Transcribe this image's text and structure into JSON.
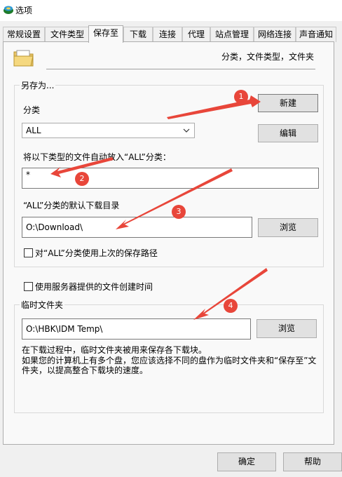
{
  "window": {
    "title": "选项"
  },
  "tabs": [
    {
      "label": "常规设置"
    },
    {
      "label": "文件类型"
    },
    {
      "label": "保存至"
    },
    {
      "label": "下载"
    },
    {
      "label": "连接"
    },
    {
      "label": "代理"
    },
    {
      "label": "站点管理"
    },
    {
      "label": "网络连接"
    },
    {
      "label": "声音通知"
    }
  ],
  "header": {
    "caption": "分类，文件类型，文件夹"
  },
  "save_as": {
    "group_title": "另存为...",
    "category_label": "分类",
    "category_value": "ALL",
    "new_button": "新建",
    "edit_button": "编辑",
    "auto_types_label": "将以下类型的文件自动放入“ALL”分类：",
    "auto_types_value": "*",
    "default_dir_label": "“ALL”分类的默认下载目录",
    "default_dir_value": "O:\\Download\\",
    "browse_button": "浏览",
    "last_path_checkbox": "对“ALL”分类使用上次的保存路径"
  },
  "server_time_checkbox": "使用服务器提供的文件创建时间",
  "temp_folder": {
    "group_title": "临时文件夹",
    "path_value": "O:\\HBK\\IDM Temp\\",
    "browse_button": "浏览",
    "note_line1": "在下载过程中，临时文件夹被用来保存各下载块。",
    "note_line2": "如果您的计算机上有多个盘，您应该选择不同的盘作为临时文件夹和“保存至”文",
    "note_line3": "件夹，以提高整合下载块的速度。"
  },
  "footer": {
    "ok_button": "确定",
    "help_button": "帮助"
  },
  "annotations": [
    "1",
    "2",
    "3",
    "4"
  ],
  "colors": {
    "arrow": "#e8463a",
    "tab_active": "#f9f9f9"
  }
}
